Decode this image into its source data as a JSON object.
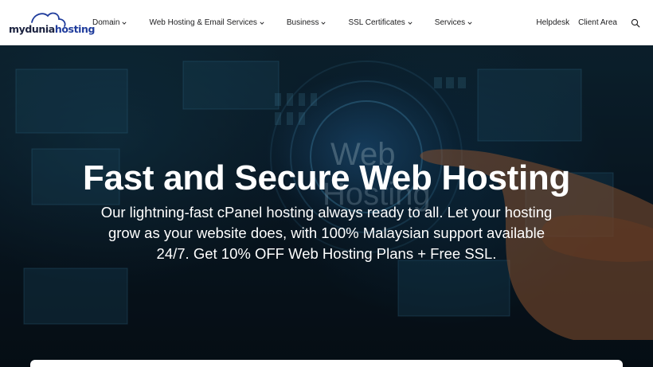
{
  "brand": {
    "name_part1": "mydunia",
    "name_part2": "hosting",
    "logo_color": "#1f3c9c"
  },
  "nav": {
    "items": [
      {
        "label": "Domain",
        "icon": "chevron-down-icon"
      },
      {
        "label": "Web Hosting & Email Services",
        "icon": "chevron-down-icon"
      },
      {
        "label": "Business",
        "icon": "chevron-down-icon"
      },
      {
        "label": "SSL Certificates",
        "icon": "chevron-down-icon"
      },
      {
        "label": "Services",
        "icon": "chevron-down-icon"
      }
    ],
    "helpdesk": "Helpdesk",
    "client_area": "Client Area",
    "search_icon": "search-icon"
  },
  "hero": {
    "title": "Fast and Secure Web Hosting",
    "subtitle": "Our lightning-fast cPanel hosting always ready to all. Let your hosting grow as your website does, with 100% Malaysian support available 24/7. Get 10% OFF Web Hosting Plans + Free SSL.",
    "background_text_line1": "Web",
    "background_text_line2": "Hosting"
  },
  "colors": {
    "text_dark": "#1d1d1f",
    "hero_dark": "#0b1d2b",
    "hero_text": "#ffffff"
  }
}
